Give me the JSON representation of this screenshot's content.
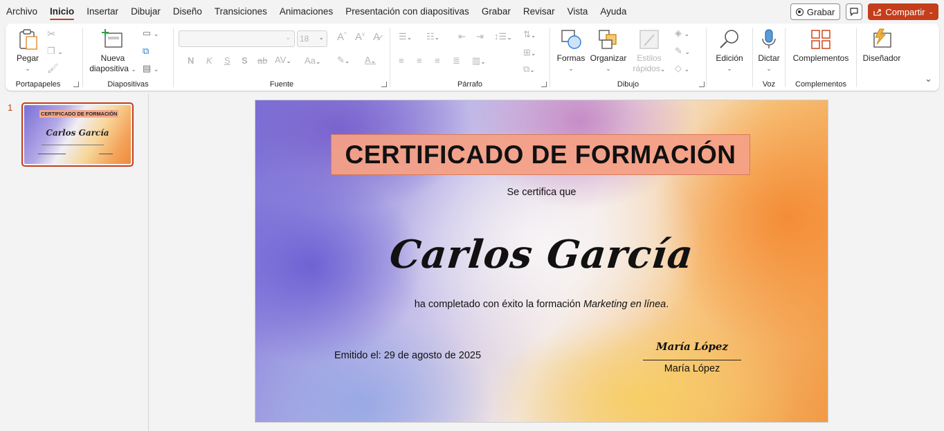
{
  "menu": {
    "tabs": [
      "Archivo",
      "Inicio",
      "Insertar",
      "Dibujar",
      "Diseño",
      "Transiciones",
      "Animaciones",
      "Presentación con diapositivas",
      "Grabar",
      "Revisar",
      "Vista",
      "Ayuda"
    ],
    "active_tab": "Inicio",
    "record_label": "Grabar",
    "share_label": "Compartir"
  },
  "ribbon": {
    "clipboard": {
      "paste_label": "Pegar",
      "group_label": "Portapapeles"
    },
    "slides": {
      "new_slide_label": "Nueva",
      "new_slide_label2": "diapositiva",
      "group_label": "Diapositivas"
    },
    "font": {
      "font_name": "",
      "font_size": "18",
      "bold": "N",
      "italic": "K",
      "underline": "S",
      "shadow": "S",
      "strike": "ab",
      "case": "Aa",
      "group_label": "Fuente"
    },
    "paragraph": {
      "group_label": "Párrafo"
    },
    "drawing": {
      "shapes_label": "Formas",
      "arrange_label": "Organizar",
      "styles_label": "Estilos",
      "styles_label2": "rápidos",
      "group_label": "Dibujo"
    },
    "editing": {
      "label": "Edición"
    },
    "voice": {
      "dictate_label": "Dictar",
      "group_label": "Voz"
    },
    "addins": {
      "label": "Complementos",
      "group_label": "Complementos"
    },
    "designer": {
      "label": "Diseñador"
    }
  },
  "thumbnails": [
    {
      "number": "1",
      "title": "CERTIFICADO DE FORMACIÓN",
      "name": "Carlos García"
    }
  ],
  "slide": {
    "title": "CERTIFICADO DE FORMACIÓN",
    "certifies": "Se certifica que",
    "recipient": "Carlos García",
    "completed_prefix": "ha completado con éxito la formación ",
    "course": "Marketing en línea",
    "completed_suffix": ".",
    "issued": "Emitido el: 29 de agosto de 2025",
    "signature": "María López",
    "signer": "María López"
  },
  "colors": {
    "accent": "#c43e1c",
    "title_fill": "#f4a086"
  }
}
